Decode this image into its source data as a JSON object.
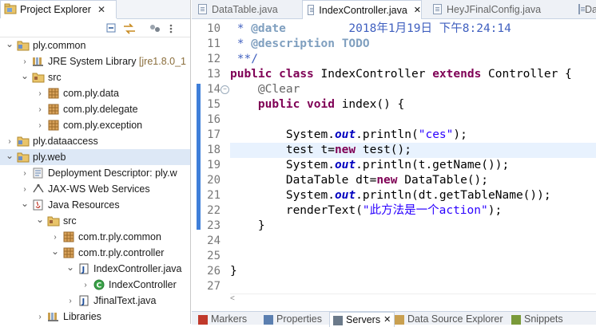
{
  "explorer": {
    "title": "Project Explorer",
    "close": "✕",
    "toolbar": [
      "collapse-all",
      "link-with-editor",
      "view-menu"
    ],
    "tree": [
      {
        "depth": 0,
        "expanded": true,
        "icon": "project-folder-icon",
        "label": "ply.common"
      },
      {
        "depth": 1,
        "expanded": false,
        "icon": "library-icon",
        "label": "JRE System Library",
        "suffix": "[jre1.8.0_1"
      },
      {
        "depth": 1,
        "expanded": true,
        "icon": "source-folder-icon",
        "label": "src"
      },
      {
        "depth": 2,
        "expanded": false,
        "icon": "package-icon",
        "label": "com.ply.data"
      },
      {
        "depth": 2,
        "expanded": false,
        "icon": "package-icon",
        "label": "com.ply.delegate"
      },
      {
        "depth": 2,
        "expanded": false,
        "icon": "package-icon",
        "label": "com.ply.exception"
      },
      {
        "depth": 0,
        "expanded": false,
        "icon": "project-folder-icon",
        "label": "ply.dataaccess"
      },
      {
        "depth": 0,
        "expanded": true,
        "icon": "project-folder-icon",
        "label": "ply.web",
        "selected": true
      },
      {
        "depth": 1,
        "expanded": false,
        "icon": "deployment-icon",
        "label": "Deployment Descriptor: ply.w"
      },
      {
        "depth": 1,
        "expanded": false,
        "icon": "web-services-icon",
        "label": "JAX-WS Web Services"
      },
      {
        "depth": 1,
        "expanded": true,
        "icon": "java-resources-icon",
        "label": "Java Resources"
      },
      {
        "depth": 2,
        "expanded": true,
        "icon": "source-folder-icon",
        "label": "src"
      },
      {
        "depth": 3,
        "expanded": false,
        "icon": "package-icon",
        "label": "com.tr.ply.common"
      },
      {
        "depth": 3,
        "expanded": true,
        "icon": "package-icon",
        "label": "com.tr.ply.controller"
      },
      {
        "depth": 4,
        "expanded": true,
        "icon": "java-file-icon",
        "label": "IndexController.java"
      },
      {
        "depth": 5,
        "expanded": false,
        "icon": "class-icon",
        "label": "IndexController"
      },
      {
        "depth": 4,
        "expanded": false,
        "icon": "java-file-icon",
        "label": "JfinalText.java"
      },
      {
        "depth": 2,
        "expanded": false,
        "icon": "library-icon",
        "label": "Libraries"
      }
    ]
  },
  "editor": {
    "tabs": [
      {
        "label": "DataTable.java",
        "active": false
      },
      {
        "label": "IndexController.java",
        "active": true,
        "close": "✕"
      },
      {
        "label": "HeyJFinalConfig.java",
        "active": false
      },
      {
        "label": "Da",
        "active": false
      }
    ],
    "lines": [
      {
        "n": "10",
        "html": "<span class=\"c\"> * </span><span class=\"cb\">@date</span><span class=\"c\">         2018年1月19日 下午8:24:14</span>"
      },
      {
        "n": "11",
        "html": "<span class=\"c\"> * </span><span class=\"cb\">@description</span><span class=\"c\"> </span><span class=\"cb\">TODO</span>"
      },
      {
        "n": "12",
        "html": "<span class=\"c\"> **/</span>"
      },
      {
        "n": "13",
        "html": "<span class=\"k\">public</span> <span class=\"k\">class</span> IndexController <span class=\"k\">extends</span> Controller {"
      },
      {
        "n": "14",
        "html": "    <span class=\"a\">@Clear</span>",
        "fold": true
      },
      {
        "n": "15",
        "html": "    <span class=\"k\">public</span> <span class=\"k\">void</span> index() {"
      },
      {
        "n": "16",
        "html": ""
      },
      {
        "n": "17",
        "html": "        System.<span class=\"f\">out</span>.println(<span class=\"s\">\"ces\"</span>);"
      },
      {
        "n": "18",
        "html": "        test t=<span class=\"k\">new</span> test();",
        "current": true
      },
      {
        "n": "19",
        "html": "        System.<span class=\"f\">out</span>.println(t.getName());"
      },
      {
        "n": "20",
        "html": "        DataTable dt=<span class=\"k\">new</span> DataTable();"
      },
      {
        "n": "21",
        "html": "        System.<span class=\"f\">out</span>.println(dt.getTableName());"
      },
      {
        "n": "22",
        "html": "        renderText(<span class=\"s\">\"此方法是一个action\"</span>);"
      },
      {
        "n": "23",
        "html": "    }"
      },
      {
        "n": "24",
        "html": ""
      },
      {
        "n": "25",
        "html": ""
      },
      {
        "n": "26",
        "html": "}"
      },
      {
        "n": "27",
        "html": ""
      }
    ]
  },
  "bottom": {
    "tabs": [
      {
        "label": "Markers",
        "active": false
      },
      {
        "label": "Properties",
        "active": false
      },
      {
        "label": "Servers",
        "active": true,
        "close": "✕"
      },
      {
        "label": "Data Source Explorer",
        "active": false
      },
      {
        "label": "Snippets",
        "active": false
      }
    ]
  },
  "colors": {
    "accent": "#3f7fd9",
    "selection": "#dde8f6",
    "current_line": "#e8f2fe"
  }
}
